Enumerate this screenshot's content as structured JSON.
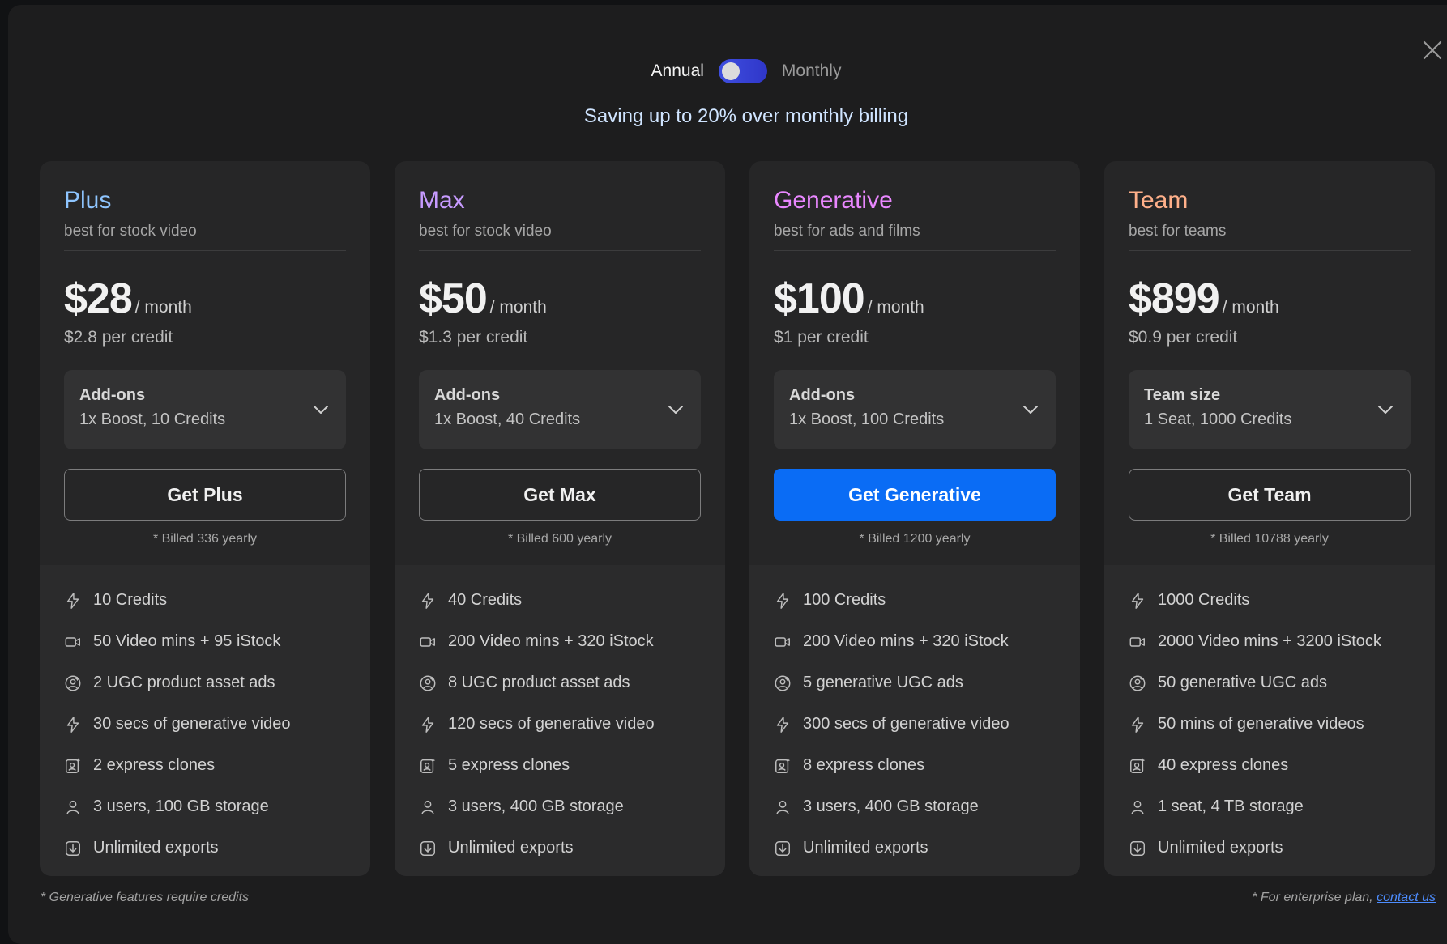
{
  "billing": {
    "annual_label": "Annual",
    "monthly_label": "Monthly",
    "saving_text": "Saving up to 20% over monthly billing"
  },
  "colors": {
    "plus": "#8ec5ff",
    "max": "#c79bff",
    "generative": "#e987ff",
    "team": "#ffb08a",
    "primary_button": "#0a6cf5"
  },
  "plans": [
    {
      "name": "Plus",
      "subtitle": "best for stock video",
      "price": "$28",
      "period": "/ month",
      "per_credit": "$2.8 per credit",
      "addon_title": "Add-ons",
      "addon_value": "1x Boost, 10 Credits",
      "cta": "Get Plus",
      "billed": "* Billed 336 yearly",
      "features": [
        "10 Credits",
        "50 Video mins + 95 iStock",
        "2 UGC product asset ads",
        "30 secs of generative video",
        "2 express clones",
        "3 users, 100 GB storage",
        "Unlimited exports"
      ]
    },
    {
      "name": "Max",
      "subtitle": "best for stock video",
      "price": "$50",
      "period": "/ month",
      "per_credit": "$1.3 per credit",
      "addon_title": "Add-ons",
      "addon_value": "1x Boost, 40 Credits",
      "cta": "Get Max",
      "billed": "* Billed 600 yearly",
      "features": [
        "40 Credits",
        "200 Video mins + 320 iStock",
        "8 UGC product asset ads",
        "120 secs of generative video",
        "5 express clones",
        "3 users, 400 GB storage",
        "Unlimited exports"
      ]
    },
    {
      "name": "Generative",
      "subtitle": "best for ads and films",
      "price": "$100",
      "period": "/ month",
      "per_credit": "$1 per credit",
      "addon_title": "Add-ons",
      "addon_value": "1x Boost, 100 Credits",
      "cta": "Get Generative",
      "billed": "* Billed 1200 yearly",
      "features": [
        "100 Credits",
        "200 Video mins + 320 iStock",
        "5 generative UGC ads",
        "300 secs of generative video",
        "8 express clones",
        "3 users, 400 GB storage",
        "Unlimited exports"
      ]
    },
    {
      "name": "Team",
      "subtitle": "best for teams",
      "price": "$899",
      "period": "/ month",
      "per_credit": "$0.9 per credit",
      "addon_title": "Team size",
      "addon_value": "1 Seat, 1000 Credits",
      "cta": "Get Team",
      "billed": "* Billed 10788 yearly",
      "features": [
        "1000 Credits",
        "2000 Video mins + 3200 iStock",
        "50 generative UGC ads",
        "50 mins of generative videos",
        "40 express clones",
        "1 seat, 4 TB storage",
        "Unlimited exports"
      ]
    }
  ],
  "feature_icons": [
    "bolt-icon",
    "video-camera-icon",
    "ugc-avatar-icon",
    "bolt-icon",
    "clone-icon",
    "user-icon",
    "download-icon"
  ],
  "footer": {
    "left": "* Generative features require credits",
    "right_prefix": "* For enterprise plan,",
    "contact_link": "contact us"
  }
}
